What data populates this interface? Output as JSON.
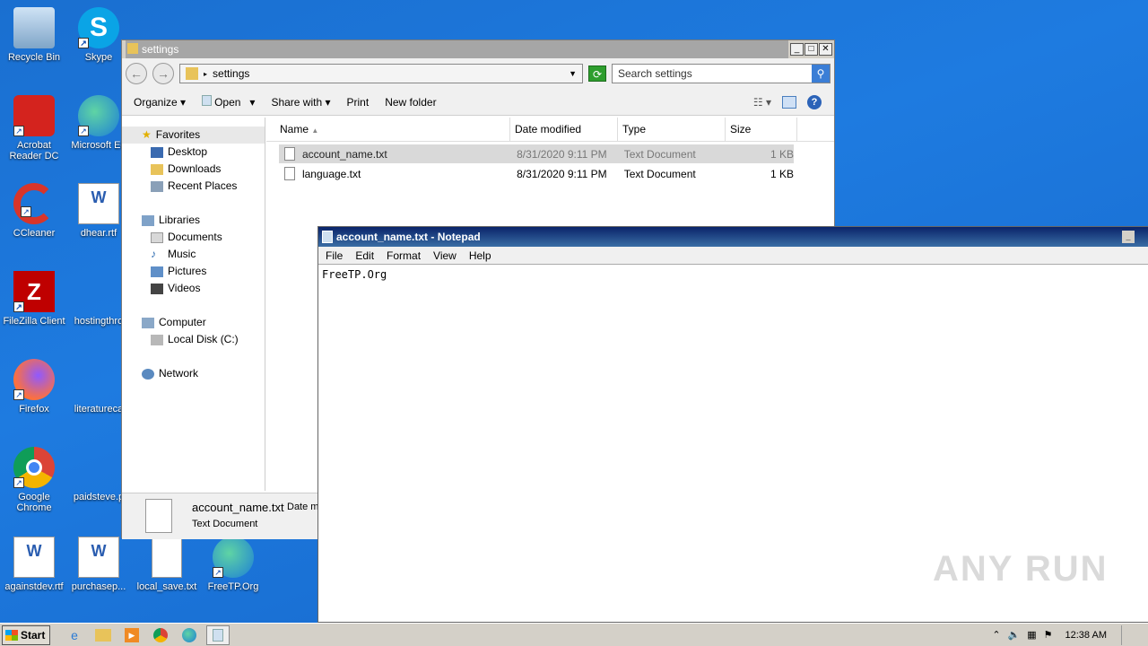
{
  "desktop": {
    "icons": [
      {
        "label": "Recycle Bin",
        "icon": "recycle-bin-icon"
      },
      {
        "label": "Skype",
        "icon": "skype-icon"
      },
      {
        "label": "Acrobat Reader DC",
        "icon": "acrobat-icon"
      },
      {
        "label": "Microsoft Ed",
        "icon": "edge-icon"
      },
      {
        "label": "CCleaner",
        "icon": "ccleaner-icon"
      },
      {
        "label": "dhear.rtf",
        "icon": "word-doc-icon"
      },
      {
        "label": "FileZilla Client",
        "icon": "filezilla-icon"
      },
      {
        "label": "hostingthro",
        "icon": "blank-icon"
      },
      {
        "label": "Firefox",
        "icon": "firefox-icon"
      },
      {
        "label": "literatureca",
        "icon": "blank-icon"
      },
      {
        "label": "Google Chrome",
        "icon": "chrome-icon"
      },
      {
        "label": "paidsteve.p",
        "icon": "blank-icon"
      },
      {
        "label": "againstdev.rtf",
        "icon": "word-doc-icon"
      },
      {
        "label": "purchasep...",
        "icon": "word-doc-icon"
      },
      {
        "label": "local_save.txt",
        "icon": "text-file-icon"
      },
      {
        "label": "FreeTP.Org",
        "icon": "edge-icon"
      }
    ]
  },
  "explorer": {
    "title": "settings",
    "address": "settings",
    "search_placeholder": "Search settings",
    "toolbar": {
      "organize": "Organize",
      "open": "Open",
      "share_with": "Share with",
      "print": "Print",
      "new_folder": "New folder"
    },
    "nav": {
      "favorites": "Favorites",
      "desktop": "Desktop",
      "downloads": "Downloads",
      "recent": "Recent Places",
      "libraries": "Libraries",
      "documents": "Documents",
      "music": "Music",
      "pictures": "Pictures",
      "videos": "Videos",
      "computer": "Computer",
      "local_disk": "Local Disk (C:)",
      "network": "Network"
    },
    "columns": {
      "name": "Name",
      "date": "Date modified",
      "type": "Type",
      "size": "Size"
    },
    "files": [
      {
        "name": "account_name.txt",
        "date": "8/31/2020 9:11 PM",
        "type": "Text Document",
        "size": "1 KB"
      },
      {
        "name": "language.txt",
        "date": "8/31/2020 9:11 PM",
        "type": "Text Document",
        "size": "1 KB"
      }
    ],
    "details": {
      "name": "account_name.txt",
      "date_label": "Date m",
      "type": "Text Document"
    }
  },
  "notepad": {
    "title": "account_name.txt - Notepad",
    "menu": {
      "file": "File",
      "edit": "Edit",
      "format": "Format",
      "view": "View",
      "help": "Help"
    },
    "content": "FreeTP.Org"
  },
  "taskbar": {
    "start": "Start",
    "clock": "12:38 AM"
  },
  "watermark": "ANY RUN"
}
